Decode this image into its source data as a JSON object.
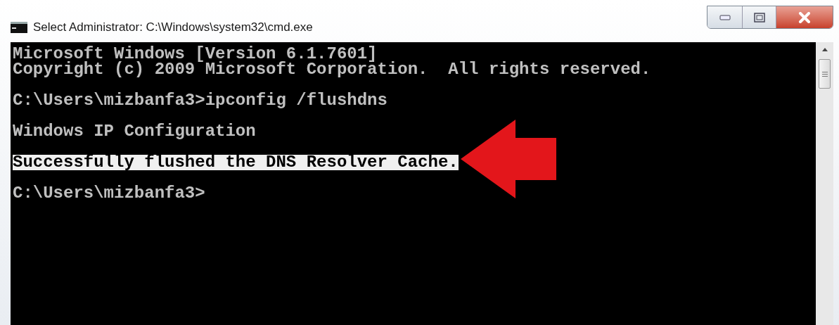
{
  "window": {
    "title": "Select Administrator: C:\\Windows\\system32\\cmd.exe"
  },
  "console": {
    "blocks": [
      {
        "lines": [
          {
            "text": "Microsoft Windows [Version 6.1.7601]",
            "selected": false
          },
          {
            "text": "Copyright (c) 2009 Microsoft Corporation.  All rights reserved.",
            "selected": false
          }
        ]
      },
      {
        "lines": [
          {
            "text": "C:\\Users\\mizbanfa3>ipconfig /flushdns",
            "selected": false
          }
        ]
      },
      {
        "lines": [
          {
            "text": "Windows IP Configuration",
            "selected": false
          }
        ]
      },
      {
        "lines": [
          {
            "text": "Successfully flushed the DNS Resolver Cache.",
            "selected": true
          }
        ]
      },
      {
        "lines": [
          {
            "text": "C:\\Users\\mizbanfa3>",
            "selected": false
          }
        ]
      }
    ]
  }
}
